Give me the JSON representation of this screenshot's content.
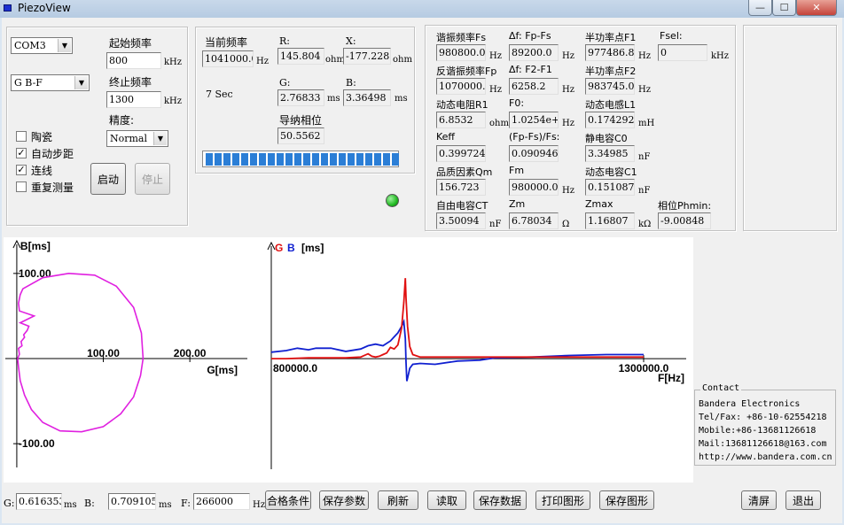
{
  "window": {
    "title": "PiezoView",
    "minimize_glyph": "—",
    "maximize_glyph": "☐",
    "close_glyph": "✕"
  },
  "sweep": {
    "port": "COM3",
    "mode": "G B-F",
    "start_label": "起始频率",
    "start_value": "800",
    "stop_label": "终止频率",
    "stop_value": "1300",
    "freq_unit": "kHz",
    "precision_label": "精度:",
    "precision_value": "Normal",
    "checkboxes": [
      {
        "label": "陶瓷",
        "checked": false
      },
      {
        "label": "自动步距",
        "checked": true
      },
      {
        "label": "连线",
        "checked": true
      },
      {
        "label": "重复测量",
        "checked": false
      }
    ],
    "start_button": "启动",
    "stop_button": "停止"
  },
  "current": {
    "freq_label": "当前频率",
    "freq_value": "1041000.0",
    "freq_unit": "Hz",
    "R_label": "R:",
    "R_value": "145.804",
    "R_unit": "ohm",
    "X_label": "X:",
    "X_value": "-177.228",
    "X_unit": "ohm",
    "time_text": "7 Sec",
    "G_label": "G:",
    "G_value": "2.76833",
    "G_unit": "ms",
    "B_label": "B:",
    "B_value": "3.36498",
    "B_unit": "ms",
    "phase_label": "导纳相位",
    "phase_value": "50.5562",
    "progress_segments": 22,
    "status_light_color": "#22bb22"
  },
  "results": [
    {
      "label": "谐振频率Fs",
      "value": "980800.0",
      "unit": "Hz"
    },
    {
      "label": "Δf: Fp-Fs",
      "value": "89200.0",
      "unit": "Hz"
    },
    {
      "label": "半功率点F1",
      "value": "977486.8",
      "unit": "Hz"
    },
    {
      "label": "Fsel:",
      "value": "0",
      "unit": "kHz"
    },
    {
      "label": "反谐振频率Fp",
      "value": "1070000.0",
      "unit": "Hz"
    },
    {
      "label": "Δf: F2-F1",
      "value": "6258.2",
      "unit": "Hz"
    },
    {
      "label": "半功率点F2",
      "value": "983745.0",
      "unit": "Hz"
    },
    {
      "label": "动态电阻R1",
      "value": "6.8532",
      "unit": "ohm"
    },
    {
      "label": "F0:",
      "value": "1.0254e+006",
      "unit": "Hz"
    },
    {
      "label": "动态电感L1",
      "value": "0.174292",
      "unit": "mH"
    },
    {
      "label": "Keff",
      "value": "0.399724",
      "unit": ""
    },
    {
      "label": "(Fp-Fs)/Fs:",
      "value": "0.0909462",
      "unit": ""
    },
    {
      "label": "静电容C0",
      "value": "3.34985",
      "unit": "nF"
    },
    {
      "label": "品质因素Qm",
      "value": "156.723",
      "unit": ""
    },
    {
      "label": "Fm",
      "value": "980000.0",
      "unit": "Hz"
    },
    {
      "label": "动态电容C1",
      "value": "0.151087",
      "unit": "nF"
    },
    {
      "label": "自由电容CT",
      "value": "3.50094",
      "unit": "nF"
    },
    {
      "label": "Zm",
      "value": "6.78034",
      "unit": "Ω"
    },
    {
      "label": "Zmax",
      "value": "1.16807",
      "unit": "kΩ"
    },
    {
      "label": "相位Phmin:",
      "value": "-9.00848",
      "unit": ""
    }
  ],
  "plots": {
    "left": {
      "ylabel": "B[ms]",
      "xlabel": "G[ms]",
      "y_top": "100.00",
      "y_bottom": "-100.00",
      "x_ticks": [
        "100.00",
        "200.00"
      ],
      "color": "#e020e0"
    },
    "right": {
      "g": "G",
      "b": "B",
      "unit": "[ms]",
      "x_start": "800000.0",
      "x_end": "1300000.0",
      "xlabel": "F[Hz]",
      "g_color": "#e01010",
      "b_color": "#1020d0"
    }
  },
  "chart_data": [
    {
      "type": "scatter",
      "title": "",
      "xlabel": "G[ms]",
      "ylabel": "B[ms]",
      "xlim": [
        -3,
        248
      ],
      "ylim": [
        -130,
        130
      ],
      "series": [
        {
          "x": [
            1,
            3,
            2,
            6,
            5,
            9,
            8,
            12,
            14,
            4,
            20,
            3,
            2,
            4,
            7,
            30,
            60,
            90,
            115,
            135,
            144,
            146,
            143,
            135,
            120,
            100,
            75,
            50,
            30,
            17,
            9,
            4,
            2,
            1
          ],
          "y": [
            0,
            5,
            12,
            15,
            20,
            25,
            28,
            33,
            38,
            42,
            50,
            56,
            65,
            75,
            82,
            95,
            100,
            98,
            85,
            60,
            30,
            0,
            -20,
            -45,
            -65,
            -80,
            -86,
            -85,
            -75,
            -60,
            -43,
            -26,
            -10,
            0
          ]
        }
      ]
    },
    {
      "type": "line",
      "title": "",
      "xlabel": "F[Hz]",
      "ylabel": "[ms]",
      "xlim": [
        800000,
        1300000
      ],
      "ylim": [
        -45,
        120
      ],
      "series": [
        {
          "name": "G",
          "x": [
            800000,
            820000,
            850000,
            870000,
            900000,
            920000,
            930000,
            935000,
            940000,
            945000,
            950000,
            955000,
            960000,
            965000,
            970000,
            975000,
            978000,
            980000,
            981000,
            983000,
            986000,
            990000,
            1000000,
            1010000,
            1050000,
            1100000,
            1200000,
            1300000
          ],
          "y": [
            0,
            0,
            1,
            1,
            1,
            2,
            6,
            3,
            2,
            3,
            5,
            7,
            14,
            12,
            17,
            38,
            70,
            100,
            75,
            40,
            15,
            5,
            2,
            2,
            2,
            2,
            2,
            2
          ]
        },
        {
          "name": "B",
          "x": [
            800000,
            820000,
            835000,
            850000,
            860000,
            880000,
            900000,
            920000,
            930000,
            940000,
            950000,
            960000,
            965000,
            970000,
            975000,
            978000,
            980000,
            981000,
            982000,
            984000,
            986000,
            990000,
            1000000,
            1020000,
            1050000,
            1080000,
            1100000,
            1150000,
            1200000,
            1250000,
            1300000
          ],
          "y": [
            8,
            10,
            13,
            11,
            13,
            13,
            9,
            12,
            16,
            18,
            16,
            22,
            27,
            32,
            40,
            46,
            25,
            -5,
            -28,
            -20,
            -12,
            -7,
            -6,
            -7,
            -3,
            -2,
            1,
            2,
            4,
            5,
            5
          ]
        }
      ]
    }
  ],
  "contact": {
    "title": "Contact",
    "lines": [
      "Bandera Electronics",
      "Tel/Fax: +86-10-62554218",
      "Mobile:+86-13681126618",
      "Mail:13681126618@163.com",
      "http://www.bandera.com.cn"
    ]
  },
  "bottom": {
    "G_label": "G:",
    "G_value": "0.616353",
    "G_unit": "ms",
    "B_label": "B:",
    "B_value": "0.709105",
    "B_unit": "ms",
    "F_label": "F:",
    "F_value": "266000",
    "F_unit": "Hz",
    "buttons": [
      "合格条件",
      "保存参数",
      "刷新",
      "读取",
      "保存数据",
      "打印图形",
      "保存图形"
    ],
    "clear_button": "清屏",
    "exit_button": "退出"
  }
}
